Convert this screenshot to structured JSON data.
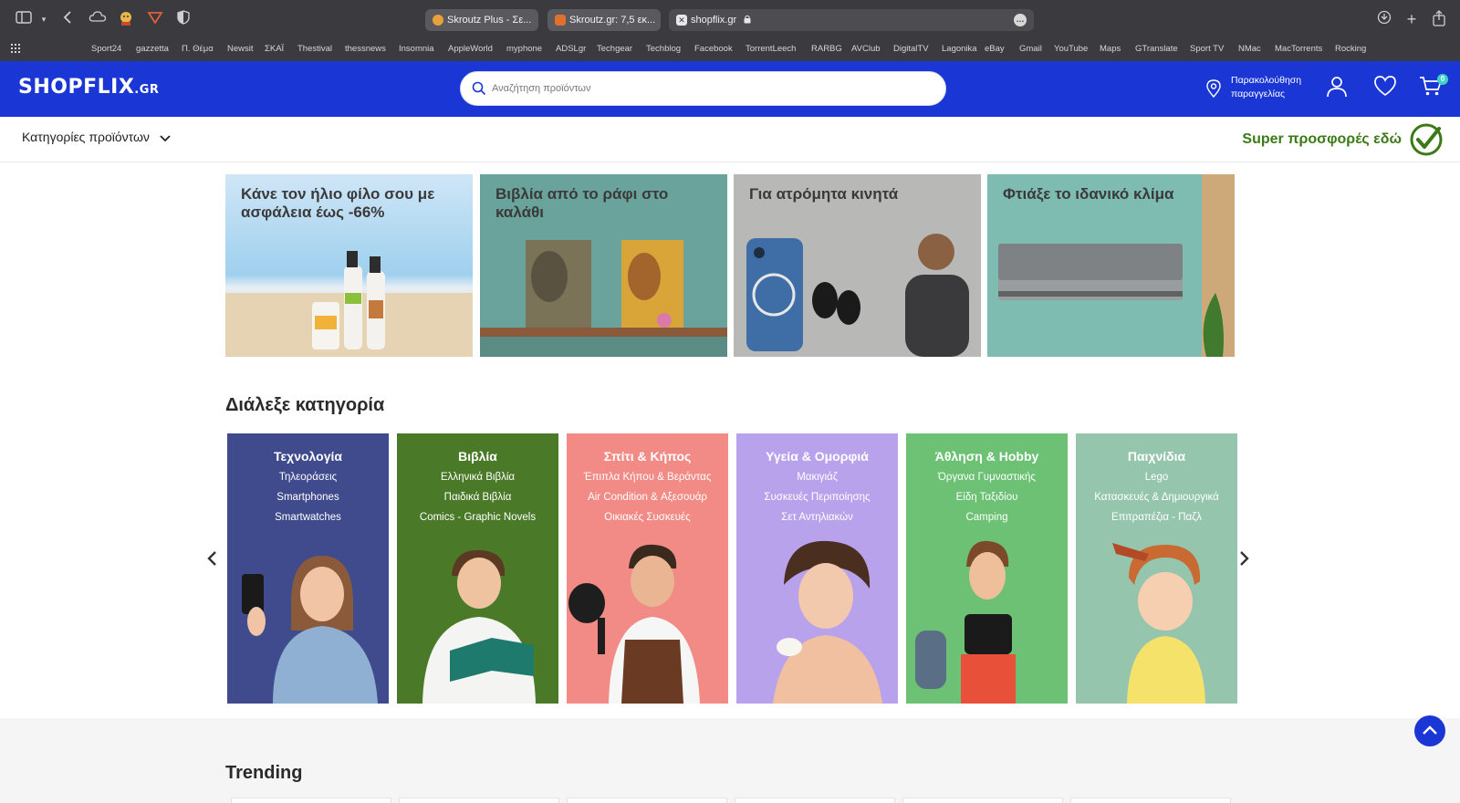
{
  "browser": {
    "tabs": [
      {
        "title": "Skroutz Plus - Σε...",
        "favicon_color": "#e8a13a"
      },
      {
        "title": "Skroutz.gr: 7,5 εκ...",
        "favicon_color": "#e0702e"
      }
    ],
    "url": "shopflix.gr",
    "bookmarks": [
      "Sport24",
      "gazzetta",
      "Π. Θέμα",
      "Newsit",
      "ΣΚΑΪ",
      "Thestival",
      "thessnews",
      "Insomnia",
      "AppleWorld",
      "myphone",
      "ADSLgr",
      "Techgear",
      "Techblog",
      "Facebook",
      "TorrentLeech",
      "RARBG",
      "AVClub",
      "DigitalTV",
      "Lagonika",
      "eBay",
      "Gmail",
      "YouTube",
      "Maps",
      "GTranslate",
      "Sport TV",
      "NMac",
      "MacTorrents",
      "Rocking"
    ]
  },
  "header": {
    "logo": "SHOPFLIX",
    "logo_suffix": ".GR",
    "search_placeholder": "Αναζήτηση προϊόντων",
    "track_order_label": "Παρακολούθηση παραγγελίας",
    "cart_count": "0",
    "brand_color": "#1a36d4"
  },
  "subnav": {
    "categories_label": "Κατηγορίες προϊόντων",
    "super_offers_label": "Super προσφορές εδώ"
  },
  "banners": [
    {
      "title": "Κάνε τον ήλιο φίλο σου με ασφάλεια έως -66%"
    },
    {
      "title": "Βιβλία από το ράφι στο καλάθι"
    },
    {
      "title": "Για ατρόμητα κινητά"
    },
    {
      "title": "Φτιάξε το ιδανικό κλίμα"
    }
  ],
  "categories_section": {
    "title": "Διάλεξε κατηγορία",
    "cards": [
      {
        "title": "Τεχνολογία",
        "items": [
          "Τηλεοράσεις",
          "Smartphones",
          "Smartwatches"
        ],
        "color": "#3f4b8c"
      },
      {
        "title": "Βιβλία",
        "items": [
          "Ελληνικά Βιβλία",
          "Παιδικά Βιβλία",
          "Comics - Graphic Novels"
        ],
        "color": "#4a7a28"
      },
      {
        "title": "Σπίτι & Κήπος",
        "items": [
          "Έπιπλα Κήπου & Βεράντας",
          "Air Condition & Αξεσουάρ",
          "Οικιακές Συσκευές"
        ],
        "color": "#f28b86"
      },
      {
        "title": "Υγεία & Ομορφιά",
        "items": [
          "Μακιγιάζ",
          "Συσκευές Περιποίησης",
          "Σετ Αντηλιακών"
        ],
        "color": "#b9a2ec"
      },
      {
        "title": "Άθληση & Hobby",
        "items": [
          "Όργανα Γυμναστικής",
          "Είδη Ταξιδίου",
          "Camping"
        ],
        "color": "#6cc174"
      },
      {
        "title": "Παιχνίδια",
        "items": [
          "Lego",
          "Κατασκευές & Δημιουργικά",
          "Επιτραπέζια - Παζλ"
        ],
        "color": "#95c6ad"
      }
    ]
  },
  "trending": {
    "title": "Trending"
  }
}
